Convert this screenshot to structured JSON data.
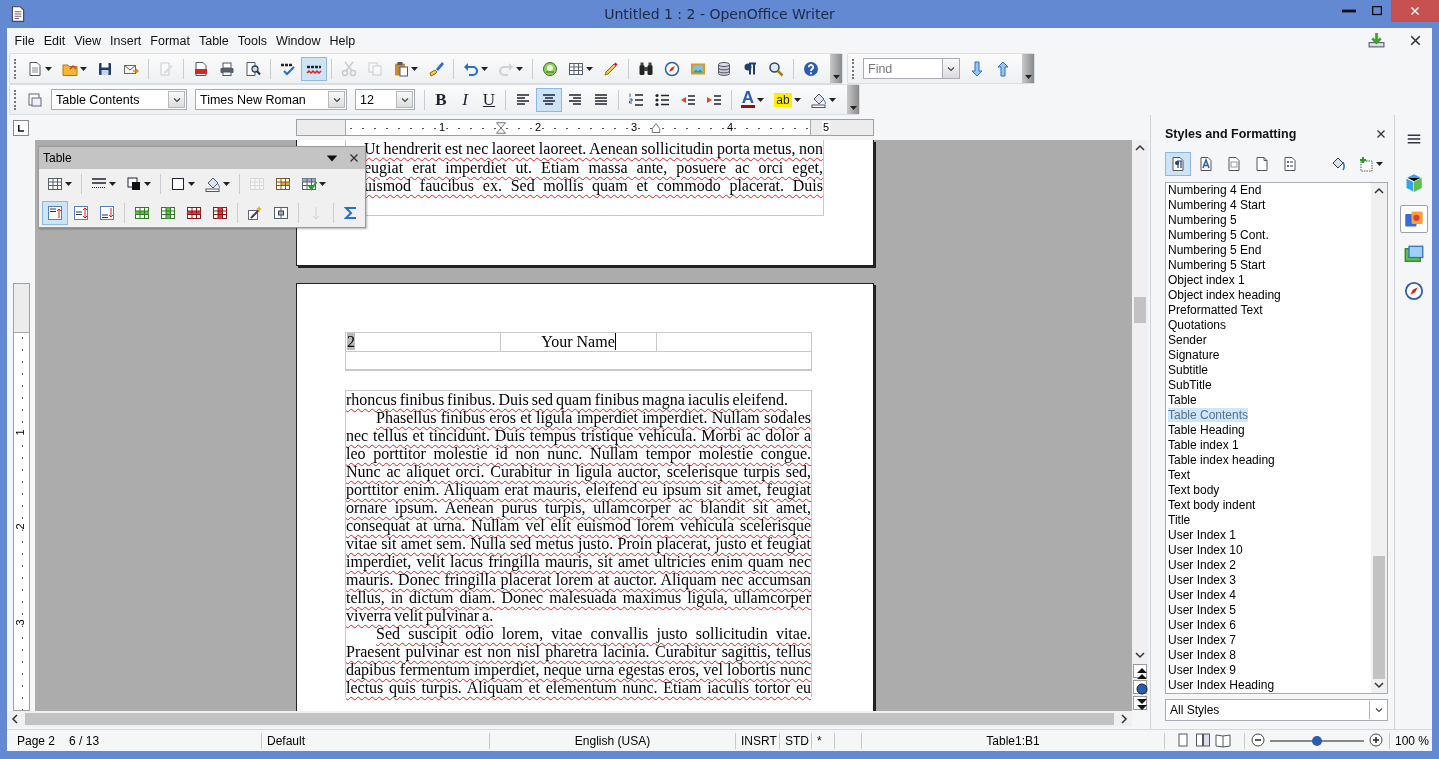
{
  "window": {
    "title": "Untitled 1 : 2 - OpenOffice Writer"
  },
  "menu": [
    "File",
    "Edit",
    "View",
    "Insert",
    "Format",
    "Table",
    "Tools",
    "Window",
    "Help"
  ],
  "toolbar_standard": {
    "items": [
      {
        "kind": "button",
        "selected": false,
        "disabled": false,
        "dropdown": true
      },
      {
        "kind": "button",
        "selected": false,
        "disabled": false,
        "dropdown": true
      },
      {
        "kind": "button",
        "selected": false,
        "disabled": false,
        "dropdown": false
      },
      {
        "kind": "button",
        "selected": false,
        "disabled": false,
        "dropdown": false
      },
      {
        "kind": "separator"
      },
      {
        "kind": "button",
        "selected": false,
        "disabled": true,
        "dropdown": false
      },
      {
        "kind": "separator"
      },
      {
        "kind": "button",
        "selected": false,
        "disabled": false,
        "dropdown": false
      },
      {
        "kind": "button",
        "selected": false,
        "disabled": false,
        "dropdown": false
      },
      {
        "kind": "button",
        "selected": false,
        "disabled": false,
        "dropdown": false
      },
      {
        "kind": "separator"
      },
      {
        "kind": "button",
        "selected": false,
        "disabled": false,
        "dropdown": false
      },
      {
        "kind": "button",
        "selected": true,
        "disabled": false,
        "dropdown": false
      },
      {
        "kind": "separator"
      },
      {
        "kind": "button",
        "selected": false,
        "disabled": true,
        "dropdown": false
      },
      {
        "kind": "button",
        "selected": false,
        "disabled": true,
        "dropdown": false
      },
      {
        "kind": "button",
        "selected": false,
        "disabled": false,
        "dropdown": true
      },
      {
        "kind": "button",
        "selected": false,
        "disabled": false,
        "dropdown": false
      },
      {
        "kind": "separator"
      },
      {
        "kind": "button",
        "selected": false,
        "disabled": false,
        "dropdown": true
      },
      {
        "kind": "button",
        "selected": false,
        "disabled": true,
        "dropdown": true
      },
      {
        "kind": "separator"
      },
      {
        "kind": "button",
        "selected": false,
        "disabled": false,
        "dropdown": false
      },
      {
        "kind": "button",
        "selected": false,
        "disabled": false,
        "dropdown": true
      },
      {
        "kind": "button",
        "selected": false,
        "disabled": false,
        "dropdown": false
      },
      {
        "kind": "separator"
      },
      {
        "kind": "button",
        "selected": false,
        "disabled": false,
        "dropdown": false
      },
      {
        "kind": "button",
        "selected": false,
        "disabled": false,
        "dropdown": false
      },
      {
        "kind": "button",
        "selected": false,
        "disabled": false,
        "dropdown": false
      },
      {
        "kind": "button",
        "selected": false,
        "disabled": false,
        "dropdown": false
      },
      {
        "kind": "button",
        "selected": false,
        "disabled": false,
        "dropdown": false
      },
      {
        "kind": "button",
        "selected": false,
        "disabled": false,
        "dropdown": false
      },
      {
        "kind": "separator"
      },
      {
        "kind": "button",
        "selected": false,
        "disabled": false,
        "dropdown": false
      }
    ]
  },
  "find_toolbar": {
    "placeholder": "Find",
    "items": [
      {
        "kind": "button",
        "selected": false,
        "disabled": false,
        "dropdown": false
      },
      {
        "kind": "button",
        "selected": false,
        "disabled": false,
        "dropdown": false
      }
    ]
  },
  "toolbar_formatting": {
    "items": [
      {
        "kind": "button",
        "selected": false,
        "disabled": false,
        "dropdown": false
      },
      {
        "kind": "combo",
        "value": "Table Contents"
      },
      {
        "kind": "combo",
        "value": "Times New Roman"
      },
      {
        "kind": "combo",
        "value": "12"
      },
      {
        "kind": "separator"
      },
      {
        "kind": "button",
        "label": "B",
        "selected": false,
        "disabled": false,
        "dropdown": false
      },
      {
        "kind": "button",
        "label": "I",
        "selected": false,
        "disabled": false,
        "dropdown": false
      },
      {
        "kind": "button",
        "label": "U",
        "selected": false,
        "disabled": false,
        "dropdown": false
      },
      {
        "kind": "separator"
      },
      {
        "kind": "button",
        "selected": false,
        "disabled": false,
        "dropdown": false
      },
      {
        "kind": "button",
        "selected": true,
        "disabled": false,
        "dropdown": false
      },
      {
        "kind": "button",
        "selected": false,
        "disabled": false,
        "dropdown": false
      },
      {
        "kind": "button",
        "selected": false,
        "disabled": false,
        "dropdown": false
      },
      {
        "kind": "separator"
      },
      {
        "kind": "button",
        "selected": false,
        "disabled": false,
        "dropdown": false
      },
      {
        "kind": "button",
        "selected": false,
        "disabled": false,
        "dropdown": false
      },
      {
        "kind": "button",
        "selected": false,
        "disabled": false,
        "dropdown": false
      },
      {
        "kind": "button",
        "selected": false,
        "disabled": false,
        "dropdown": false
      },
      {
        "kind": "separator"
      },
      {
        "kind": "button",
        "label": "A",
        "selected": false,
        "disabled": false,
        "dropdown": true
      },
      {
        "kind": "button",
        "label": "ab",
        "selected": false,
        "disabled": false,
        "dropdown": true
      },
      {
        "kind": "button",
        "selected": false,
        "disabled": false,
        "dropdown": true
      }
    ]
  },
  "ruler": {
    "marks": [
      "1",
      "2",
      "3",
      "4",
      "5"
    ]
  },
  "vertical_ruler": {
    "marks": [
      "1",
      "2",
      "3"
    ]
  },
  "table_toolbar": {
    "title": "Table",
    "rows": [
      {
        "items": [
          {
            "kind": "button",
            "selected": false,
            "disabled": false,
            "dropdown": true
          },
          {
            "kind": "separator"
          },
          {
            "kind": "button",
            "selected": false,
            "disabled": false,
            "dropdown": true
          },
          {
            "kind": "button",
            "selected": false,
            "disabled": false,
            "dropdown": true
          },
          {
            "kind": "separator"
          },
          {
            "kind": "button",
            "selected": false,
            "disabled": false,
            "dropdown": true
          },
          {
            "kind": "button",
            "selected": false,
            "disabled": false,
            "dropdown": true
          },
          {
            "kind": "separator"
          },
          {
            "kind": "button",
            "selected": false,
            "disabled": true,
            "dropdown": false
          },
          {
            "kind": "button",
            "selected": false,
            "disabled": false,
            "dropdown": false
          },
          {
            "kind": "button",
            "selected": false,
            "disabled": false,
            "dropdown": true
          }
        ]
      },
      {
        "items": [
          {
            "kind": "button",
            "selected": true,
            "disabled": false,
            "dropdown": false
          },
          {
            "kind": "button",
            "selected": false,
            "disabled": false,
            "dropdown": false
          },
          {
            "kind": "button",
            "selected": false,
            "disabled": false,
            "dropdown": false
          },
          {
            "kind": "separator"
          },
          {
            "kind": "button",
            "selected": false,
            "disabled": false,
            "dropdown": false
          },
          {
            "kind": "button",
            "selected": false,
            "disabled": false,
            "dropdown": false
          },
          {
            "kind": "button",
            "selected": false,
            "disabled": false,
            "dropdown": false
          },
          {
            "kind": "button",
            "selected": false,
            "disabled": false,
            "dropdown": false
          },
          {
            "kind": "separator"
          },
          {
            "kind": "button",
            "selected": false,
            "disabled": false,
            "dropdown": false
          },
          {
            "kind": "button",
            "selected": false,
            "disabled": false,
            "dropdown": false
          },
          {
            "kind": "separator"
          },
          {
            "kind": "button",
            "selected": false,
            "disabled": true,
            "dropdown": false
          },
          {
            "kind": "separator"
          },
          {
            "kind": "button",
            "selected": false,
            "disabled": false,
            "dropdown": false
          }
        ]
      }
    ]
  },
  "document": {
    "page1_lines": [
      "Ut hendrerit est nec laoreet laoreet. Aenean sollicitudin porta metus, non",
      "eugiat erat imperdiet ut. Etiam massa ante, posuere ac orci eget,",
      "uismod faucibus ex. Sed mollis quam et commodo placerat. Duis"
    ],
    "header": {
      "page_number": "2",
      "author": "Your Name"
    },
    "paragraphs": [
      {
        "indent": false,
        "ends": true,
        "lines": [
          "rhoncus finibus finibus. Duis sed quam finibus magna iaculis eleifend."
        ]
      },
      {
        "indent": true,
        "ends": true,
        "lines": [
          "Phasellus finibus eros et ligula imperdiet imperdiet. Nullam sodales",
          "nec tellus et tincidunt. Duis tempus tristique vehicula. Morbi ac dolor a",
          "leo porttitor molestie id non nunc. Nullam tempor molestie congue.",
          "Nunc ac aliquet orci. Curabitur in ligula auctor, scelerisque turpis sed,",
          "porttitor enim. Aliquam erat mauris, eleifend eu ipsum sit amet, feugiat",
          "ornare ipsum. Aenean purus turpis, ullamcorper ac blandit sit amet,",
          "consequat at urna. Nullam vel elit euismod lorem vehicula scelerisque",
          "vitae sit amet sem. Nulla sed metus justo. Proin placerat, justo et feugiat",
          "imperdiet, velit lacus fringilla mauris, sit amet ultricies enim quam nec",
          "mauris. Donec fringilla placerat lorem at auctor. Aliquam nec accumsan",
          "tellus, in dictum diam. Donec malesuada maximus ligula, ullamcorper",
          "viverra velit pulvinar a."
        ]
      },
      {
        "indent": true,
        "ends": false,
        "lines": [
          "Sed suscipit odio lorem, vitae convallis justo sollicitudin vitae.",
          "Praesent pulvinar est non nisl pharetra lacinia. Curabitur sagittis, tellus",
          "dapibus fermentum imperdiet, neque urna egestas eros, vel lobortis nunc",
          "lectus quis turpis. Aliquam et elementum nunc. Etiam iaculis tortor eu"
        ]
      }
    ]
  },
  "styles_panel": {
    "title": "Styles and Formatting",
    "families": [
      {
        "selected": true
      },
      {
        "selected": false
      },
      {
        "selected": false
      },
      {
        "selected": false
      },
      {
        "selected": false
      }
    ],
    "items": [
      {
        "name": "Numbering 4 End",
        "selected": false
      },
      {
        "name": "Numbering 4 Start",
        "selected": false
      },
      {
        "name": "Numbering 5",
        "selected": false
      },
      {
        "name": "Numbering 5 Cont.",
        "selected": false
      },
      {
        "name": "Numbering 5 End",
        "selected": false
      },
      {
        "name": "Numbering 5 Start",
        "selected": false
      },
      {
        "name": "Object index 1",
        "selected": false
      },
      {
        "name": "Object index heading",
        "selected": false
      },
      {
        "name": "Preformatted Text",
        "selected": false
      },
      {
        "name": "Quotations",
        "selected": false
      },
      {
        "name": "Sender",
        "selected": false
      },
      {
        "name": "Signature",
        "selected": false
      },
      {
        "name": "Subtitle",
        "selected": false
      },
      {
        "name": "SubTitle",
        "selected": false
      },
      {
        "name": "Table",
        "selected": false
      },
      {
        "name": "Table Contents",
        "selected": true
      },
      {
        "name": "Table Heading",
        "selected": false
      },
      {
        "name": "Table index 1",
        "selected": false
      },
      {
        "name": "Table index heading",
        "selected": false
      },
      {
        "name": "Text",
        "selected": false
      },
      {
        "name": "Text body",
        "selected": false
      },
      {
        "name": "Text body indent",
        "selected": false
      },
      {
        "name": "Title",
        "selected": false
      },
      {
        "name": "User Index 1",
        "selected": false
      },
      {
        "name": "User Index 10",
        "selected": false
      },
      {
        "name": "User Index 2",
        "selected": false
      },
      {
        "name": "User Index 3",
        "selected": false
      },
      {
        "name": "User Index 4",
        "selected": false
      },
      {
        "name": "User Index 5",
        "selected": false
      },
      {
        "name": "User Index 6",
        "selected": false
      },
      {
        "name": "User Index 7",
        "selected": false
      },
      {
        "name": "User Index 8",
        "selected": false
      },
      {
        "name": "User Index 9",
        "selected": false
      },
      {
        "name": "User Index Heading",
        "selected": false
      }
    ],
    "filter": "All Styles"
  },
  "sidebar_tabs": [
    {
      "selected": false
    },
    {
      "selected": true
    },
    {
      "selected": false
    },
    {
      "selected": false
    }
  ],
  "status_bar": {
    "page": "Page 2",
    "page_count": "6 / 13",
    "page_style": "Default",
    "language": "English (USA)",
    "insert_mode": "INSRT",
    "selection_mode": "STD",
    "modified": "*",
    "cell": "Table1:B1",
    "zoom": {
      "level": 0.5,
      "text": "100 %"
    }
  }
}
